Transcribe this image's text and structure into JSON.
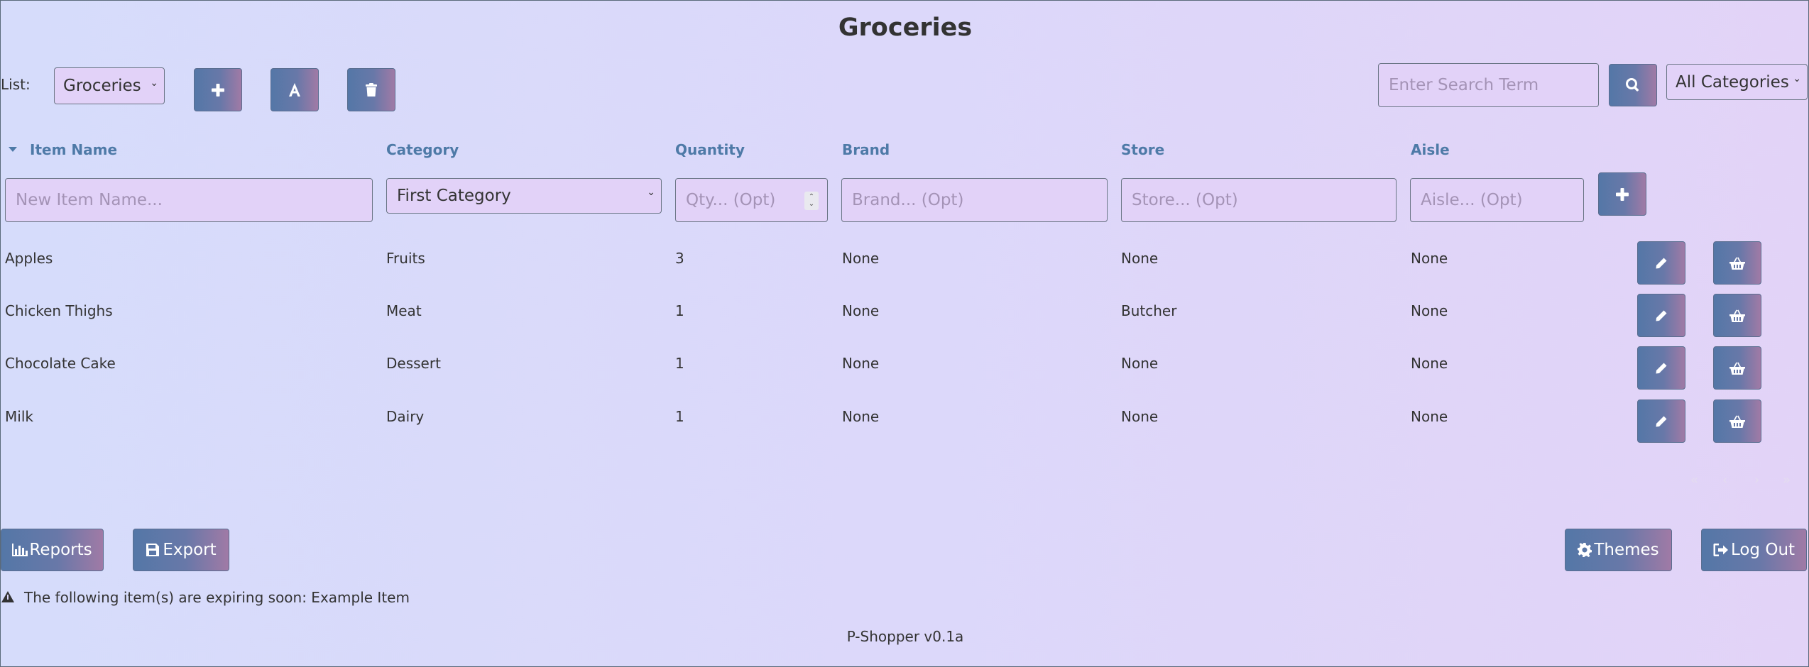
{
  "page_title": "Groceries",
  "list_selector": {
    "label": "List:",
    "selected": "Groceries"
  },
  "search": {
    "placeholder": "Enter Search Term",
    "category_selected": "All Categories"
  },
  "table": {
    "headers": {
      "item_name": "Item Name",
      "category": "Category",
      "quantity": "Quantity",
      "brand": "Brand",
      "store": "Store",
      "aisle": "Aisle"
    },
    "new_item": {
      "name_placeholder": "New Item Name...",
      "category_selected": "First Category",
      "qty_placeholder": "Qty... (Opt)",
      "brand_placeholder": "Brand... (Opt)",
      "store_placeholder": "Store... (Opt)",
      "aisle_placeholder": "Aisle... (Opt)"
    },
    "rows": [
      {
        "name": "Apples",
        "category": "Fruits",
        "quantity": "3",
        "brand": "None",
        "store": "None",
        "aisle": "None"
      },
      {
        "name": "Chicken Thighs",
        "category": "Meat",
        "quantity": "1",
        "brand": "None",
        "store": "Butcher",
        "aisle": "None"
      },
      {
        "name": "Chocolate Cake",
        "category": "Dessert",
        "quantity": "1",
        "brand": "None",
        "store": "None",
        "aisle": "None"
      },
      {
        "name": "Milk",
        "category": "Dairy",
        "quantity": "1",
        "brand": "None",
        "store": "None",
        "aisle": "None"
      }
    ]
  },
  "footer": {
    "reports_label": "Reports",
    "export_label": "Export",
    "themes_label": "Themes",
    "logout_label": "Log Out",
    "expiring_notice": "The following item(s) are expiring soon: Example Item",
    "version": "P-Shopper v0.1a"
  },
  "colors": {
    "accent_start": "#5477a7",
    "accent_end": "#a07aa6",
    "header_text": "#4e7aa7",
    "field_bg": "#e2d2f8"
  },
  "icons": [
    "plus-icon",
    "font-icon",
    "trash-icon",
    "search-icon",
    "caret-down-icon",
    "pencil-icon",
    "basket-icon",
    "bar-chart-icon",
    "floppy-disk-icon",
    "cog-icon",
    "sign-out-icon",
    "warning-icon"
  ]
}
